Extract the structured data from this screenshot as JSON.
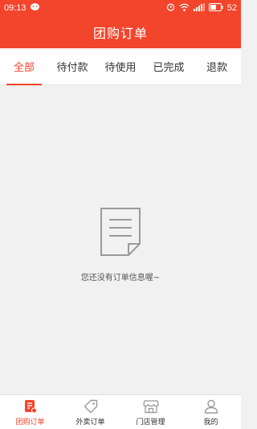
{
  "status_bar": {
    "time": "09:13",
    "battery": "52",
    "icons": [
      "notification-icon",
      "alarm-icon",
      "wifi-icon",
      "signal-icon",
      "battery-icon"
    ]
  },
  "header": {
    "title": "团购订单"
  },
  "tabs": [
    {
      "label": "全部",
      "active": true
    },
    {
      "label": "待付款",
      "active": false
    },
    {
      "label": "待使用",
      "active": false
    },
    {
      "label": "已完成",
      "active": false
    },
    {
      "label": "退款",
      "active": false
    }
  ],
  "empty_state": {
    "icon": "document-icon",
    "message": "您还没有订单信息喔~"
  },
  "bottom_nav": [
    {
      "label": "团购订单",
      "icon": "order-list-icon",
      "active": true
    },
    {
      "label": "外卖订单",
      "icon": "tag-icon",
      "active": false
    },
    {
      "label": "门店管理",
      "icon": "store-icon",
      "active": false
    },
    {
      "label": "我的",
      "icon": "person-icon",
      "active": false
    }
  ],
  "colors": {
    "accent": "#f2452b",
    "background": "#f1f1f1",
    "inactive_icon": "#999999"
  }
}
